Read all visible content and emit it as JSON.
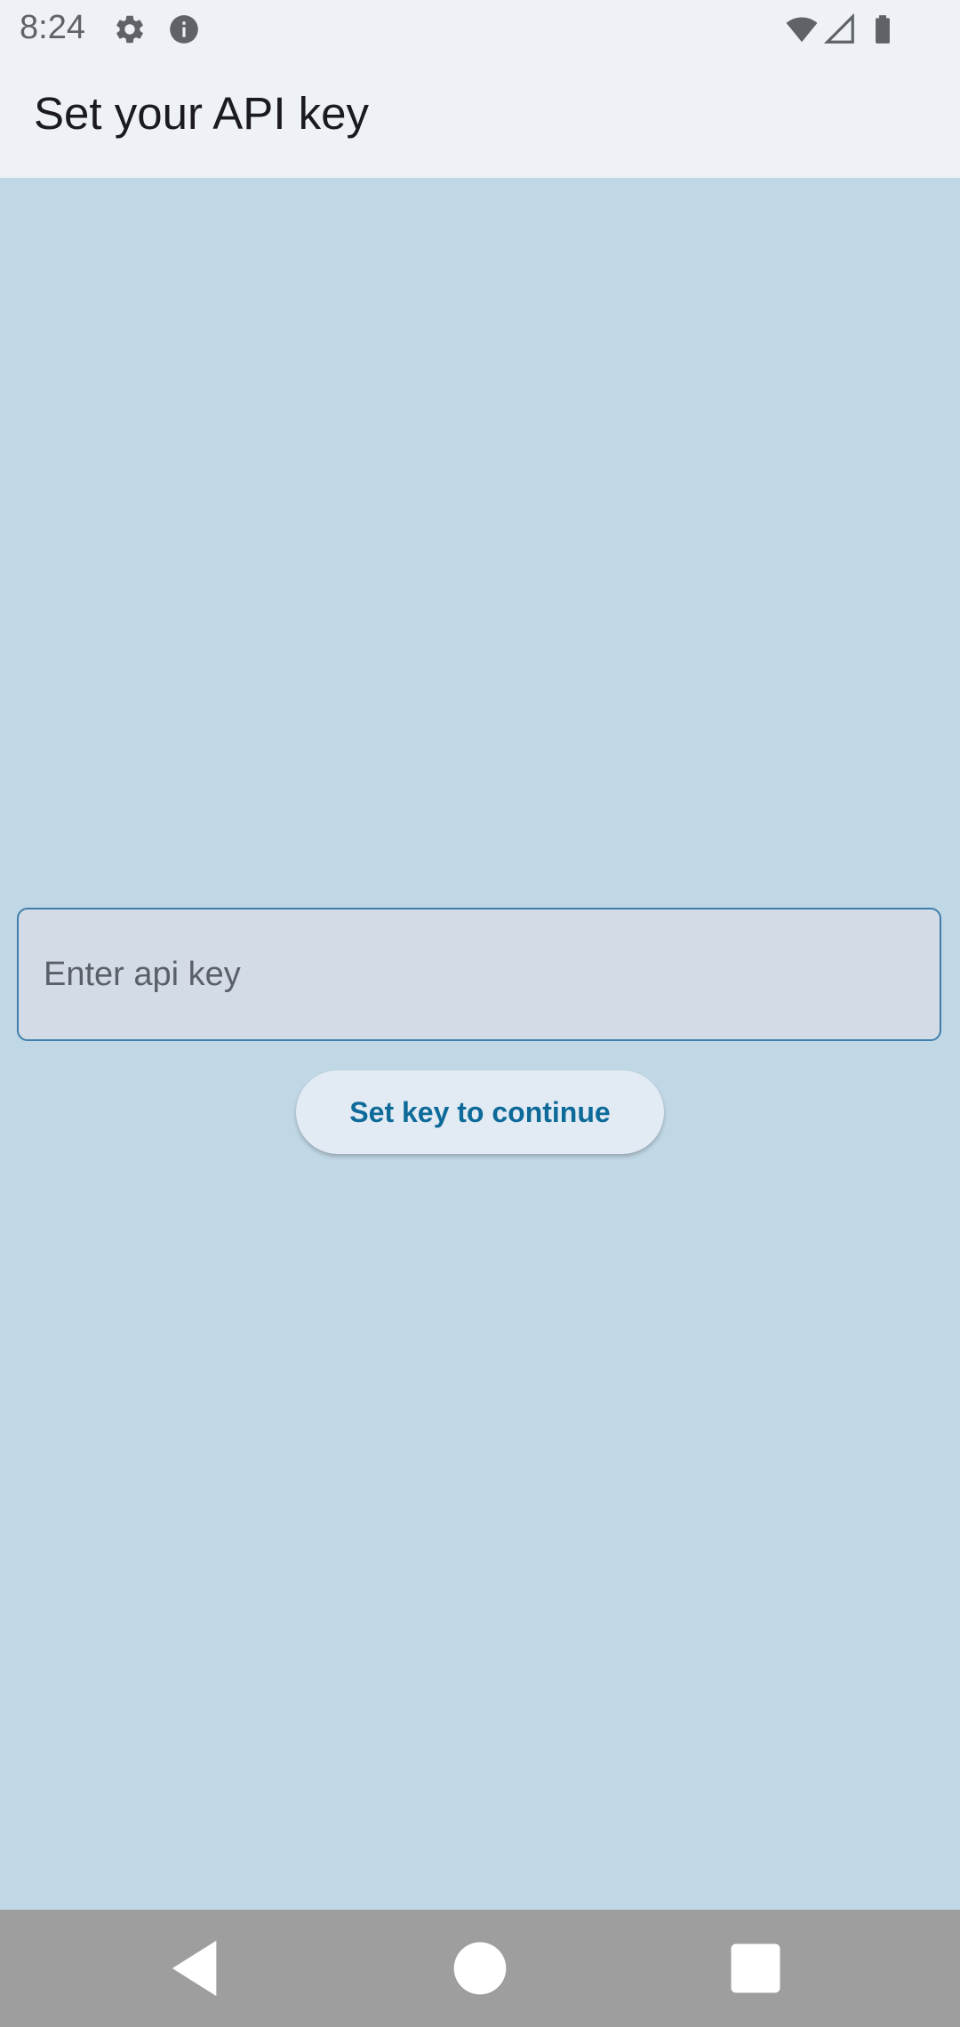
{
  "status_bar": {
    "time": "8:24",
    "icons": [
      "gear-icon",
      "info-icon",
      "wifi-icon",
      "signal-icon",
      "battery-icon"
    ]
  },
  "app_bar": {
    "title": "Set your API key"
  },
  "form": {
    "input_placeholder": "Enter api key",
    "input_value": "",
    "button_label": "Set key to continue"
  },
  "nav_bar": {
    "buttons": [
      "back-icon",
      "home-icon",
      "recents-icon"
    ]
  },
  "colors": {
    "background": "#c0d7e5",
    "bar_background": "#eef2f7",
    "accent": "#0d6a99",
    "input_border": "#3f7eaa"
  }
}
